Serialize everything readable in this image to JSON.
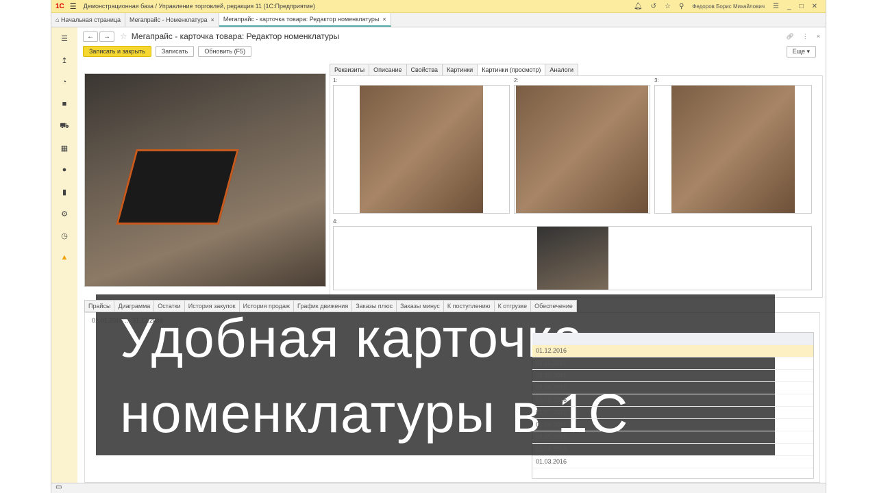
{
  "window": {
    "title": "Демонстрационная база / Управление торговлей, редакция 11  (1С:Предприятие)",
    "user": "Федоров Борис Михайлович",
    "logo": "1С"
  },
  "tabs": [
    {
      "label": "Начальная страница"
    },
    {
      "label": "Мегапрайс - Номенклатура"
    },
    {
      "label": "Мегапрайс - карточка товара: Редактор номенклатуры"
    }
  ],
  "form": {
    "title": "Мегапрайс - карточка товара: Редактор номенклатуры",
    "save_close": "Записать и закрыть",
    "save": "Записать",
    "refresh": "Обновить (F5)",
    "more": "Еще ▾"
  },
  "right_tabs": [
    "Реквизиты",
    "Описание",
    "Свойства",
    "Картинки",
    "Картинки (просмотр)",
    "Аналоги"
  ],
  "gallery_labels": [
    "1:",
    "2:",
    "3:",
    "4:"
  ],
  "bottom_tabs": [
    "Прайсы",
    "Диаграмма",
    "Остатки",
    "История закупок",
    "История продаж",
    "График движения",
    "Заказы плюс",
    "Заказы минус",
    "К поступлению",
    "К отгрузке",
    "Обеспечение"
  ],
  "period": {
    "from": "01.01.2016",
    "to": "31.12.2016"
  },
  "list_rows": [
    "01.12.2016",
    "01.11.2016",
    "01.10.2016",
    "01.09.2016",
    "01.08.2016",
    "01.07.2016",
    "01.06.2016",
    "01.05.2016",
    "01.04.2016",
    "01.03.2016"
  ],
  "overlay": {
    "line1": "Удобная карточка",
    "line2": "номенклатуры в 1С"
  }
}
